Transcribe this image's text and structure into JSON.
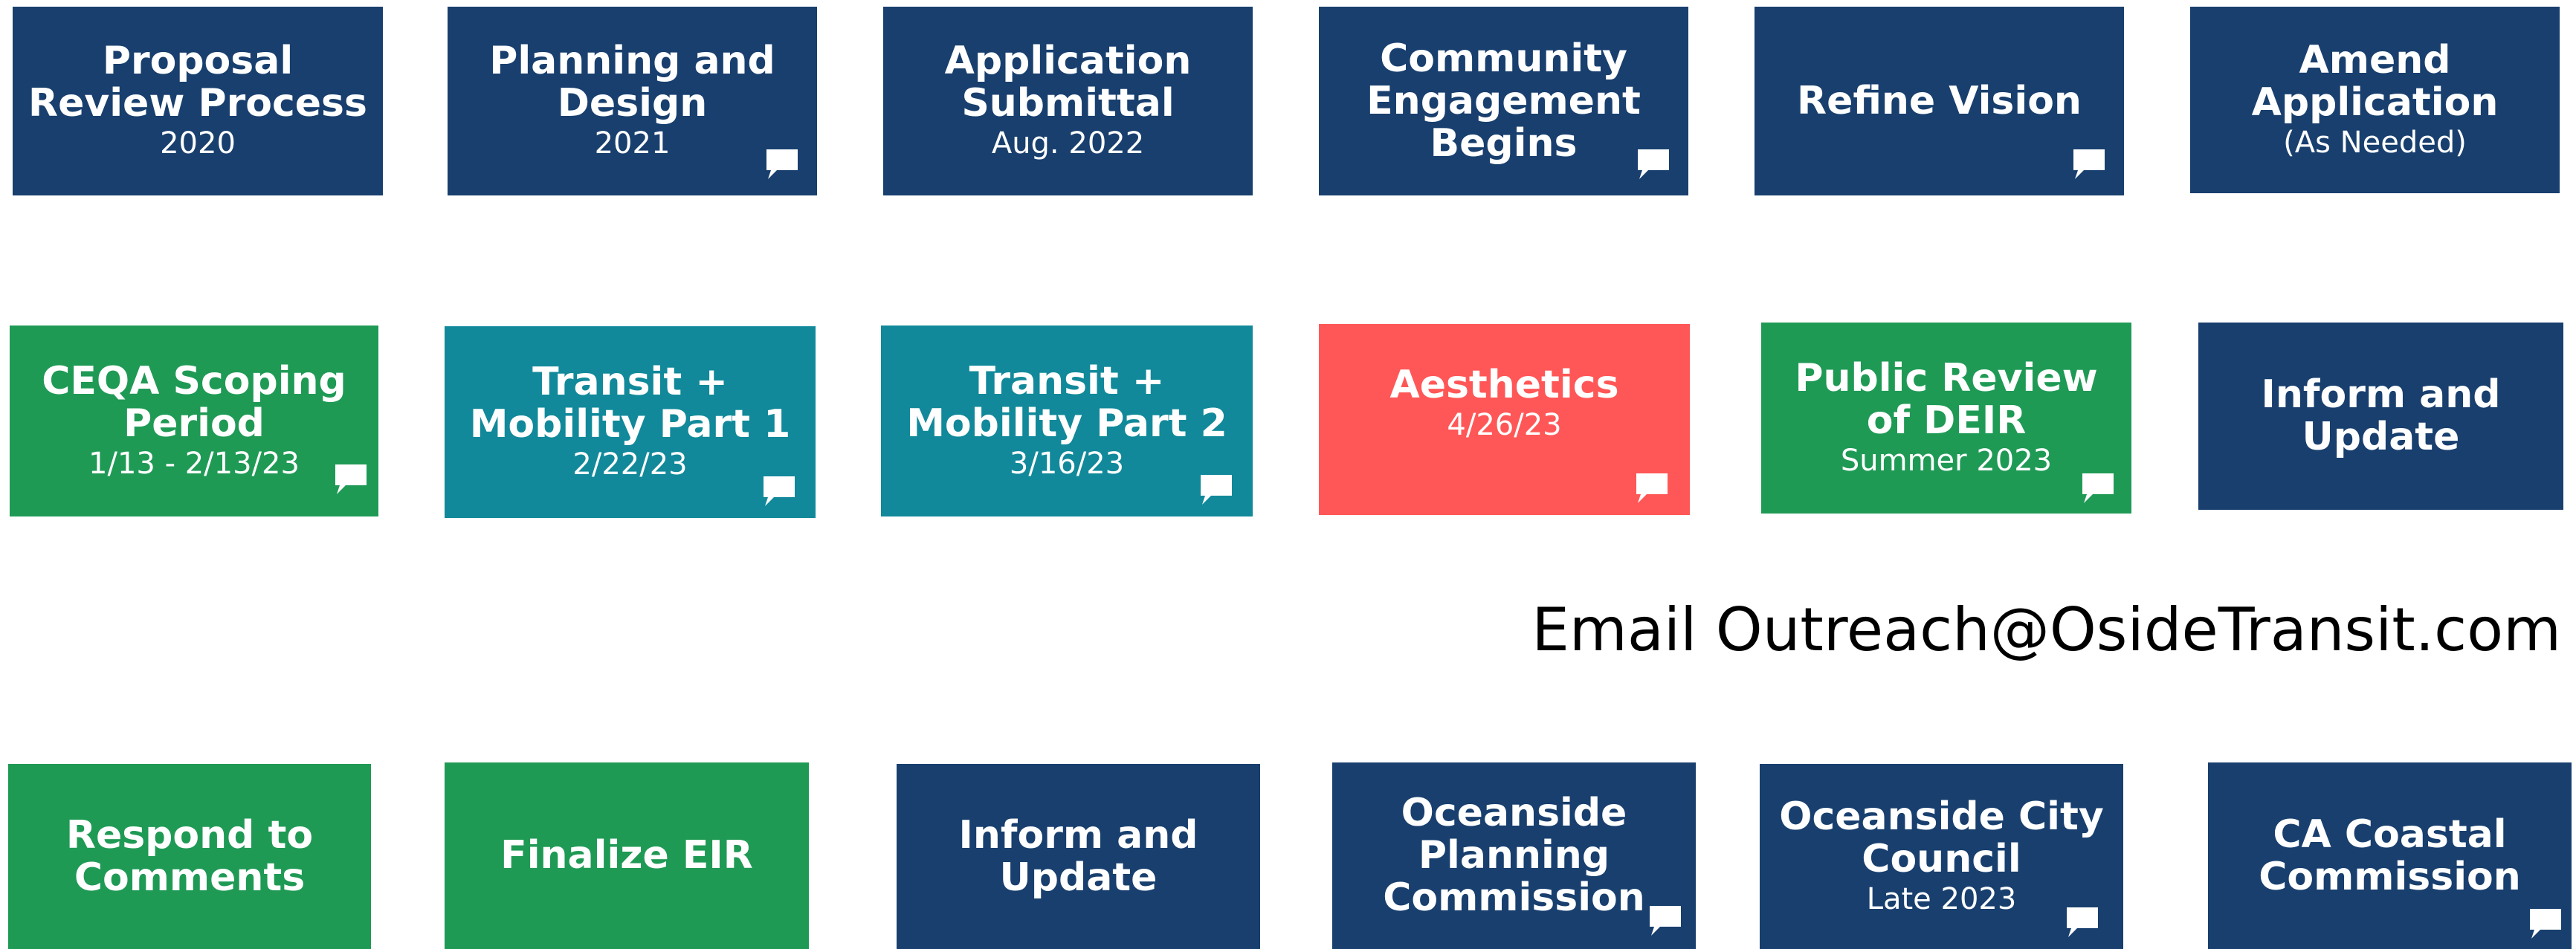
{
  "colors": {
    "navy": "#183f6e",
    "green": "#1f9a55",
    "teal": "#11899a",
    "red": "#ff5757",
    "text": "#ffffff"
  },
  "steps": [
    {
      "title": "Proposal Review Process",
      "sub": "2020",
      "color": "navy",
      "comment": false
    },
    {
      "title": "Planning and Design",
      "sub": "2021",
      "color": "navy",
      "comment": true
    },
    {
      "title": "Application Submittal",
      "sub": "Aug. 2022",
      "color": "navy",
      "comment": false
    },
    {
      "title": "Community Engagement Begins",
      "sub": "",
      "color": "navy",
      "comment": true
    },
    {
      "title": "Refine Vision",
      "sub": "",
      "color": "navy",
      "comment": true
    },
    {
      "title": "Amend Application",
      "sub": "(As Needed)",
      "color": "navy",
      "comment": false
    },
    {
      "title": "CEQA Scoping Period",
      "sub": "1/13 - 2/13/23",
      "color": "green",
      "comment": true
    },
    {
      "title": "Transit + Mobility Part 1",
      "sub": "2/22/23",
      "color": "teal",
      "comment": true
    },
    {
      "title": "Transit + Mobility Part 2",
      "sub": "3/16/23",
      "color": "teal",
      "comment": true
    },
    {
      "title": "Aesthetics",
      "sub": "4/26/23",
      "color": "red",
      "comment": true
    },
    {
      "title": "Public Review of DEIR",
      "sub": "Summer 2023",
      "color": "green",
      "comment": true
    },
    {
      "title": "Inform and Update",
      "sub": "",
      "color": "navy",
      "comment": false
    },
    {
      "title": "Respond to Comments",
      "sub": "",
      "color": "green",
      "comment": false
    },
    {
      "title": "Finalize EIR",
      "sub": "",
      "color": "green",
      "comment": false
    },
    {
      "title": "Inform and Update",
      "sub": "",
      "color": "navy",
      "comment": false
    },
    {
      "title": "Oceanside Planning Commission",
      "sub": "",
      "color": "navy",
      "comment": true
    },
    {
      "title": "Oceanside City Council",
      "sub": "Late 2023",
      "color": "navy",
      "comment": true
    },
    {
      "title": "CA Coastal Commission",
      "sub": "",
      "color": "navy",
      "comment": true
    }
  ],
  "email": "Email Outreach@OsideTransit.com",
  "icons": {
    "comment": "speech-bubble-icon"
  }
}
